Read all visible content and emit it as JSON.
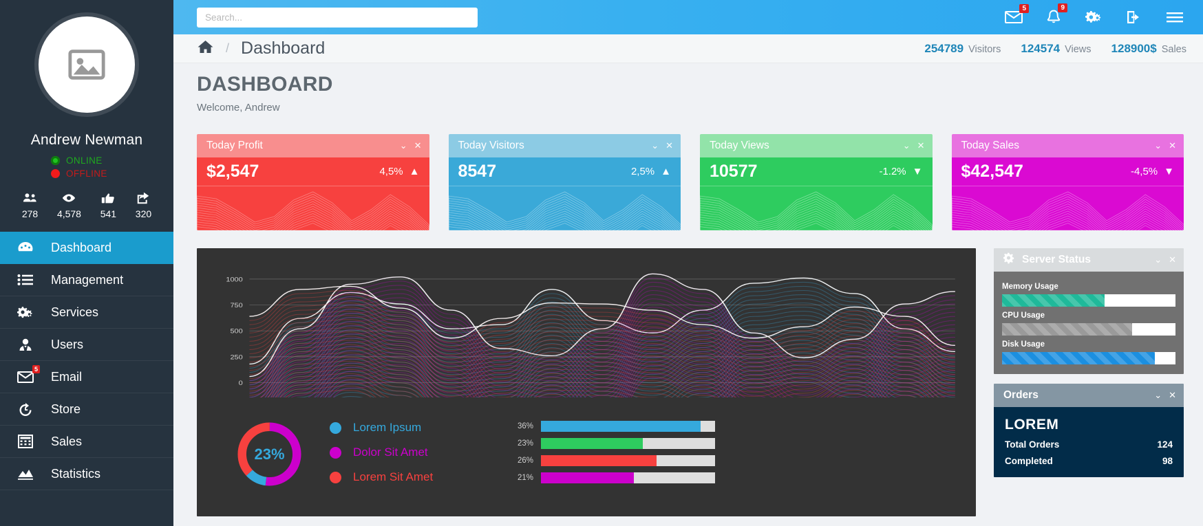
{
  "sidebar": {
    "user": {
      "name": "Andrew Newman",
      "avatar_icon": "image-placeholder-icon",
      "status_online": "ONLINE",
      "status_offline": "OFFLINE"
    },
    "metrics": [
      {
        "icon": "users-icon",
        "value": "278"
      },
      {
        "icon": "eye-icon",
        "value": "4,578"
      },
      {
        "icon": "thumbs-up-icon",
        "value": "541"
      },
      {
        "icon": "share-icon",
        "value": "320"
      }
    ],
    "items": [
      {
        "label": "Dashboard",
        "icon": "dashboard-icon",
        "active": true,
        "badge": ""
      },
      {
        "label": "Management",
        "icon": "list-icon",
        "active": false,
        "badge": ""
      },
      {
        "label": "Services",
        "icon": "gears-icon",
        "active": false,
        "badge": ""
      },
      {
        "label": "Users",
        "icon": "user-icon",
        "active": false,
        "badge": ""
      },
      {
        "label": "Email",
        "icon": "envelope-icon",
        "active": false,
        "badge": "5"
      },
      {
        "label": "Store",
        "icon": "history-icon",
        "active": false,
        "badge": ""
      },
      {
        "label": "Sales",
        "icon": "calculator-icon",
        "active": false,
        "badge": ""
      },
      {
        "label": "Statistics",
        "icon": "area-chart-icon",
        "active": false,
        "badge": ""
      }
    ]
  },
  "topbar": {
    "search_placeholder": "Search...",
    "icons": [
      {
        "name": "envelope-icon",
        "badge": "5"
      },
      {
        "name": "bell-icon",
        "badge": "9"
      },
      {
        "name": "gears-icon",
        "badge": ""
      },
      {
        "name": "logout-icon",
        "badge": ""
      },
      {
        "name": "hamburger-icon",
        "badge": ""
      }
    ]
  },
  "breadcrumb": {
    "home_icon": "home-icon",
    "separator": "/",
    "title": "Dashboard",
    "stats": [
      {
        "value": "254789",
        "label": "Visitors"
      },
      {
        "value": "124574",
        "label": "Views"
      },
      {
        "value": "128900$",
        "label": "Sales"
      }
    ]
  },
  "page": {
    "heading": "DASHBOARD",
    "welcome": "Welcome, Andrew"
  },
  "stat_cards": [
    {
      "title": "Today Profit",
      "value": "$2,547",
      "percent": "4,5%",
      "arrow": "▲",
      "head_color": "#f88e8e",
      "body_color": "#f7413f",
      "spark_color": "#ffb3b3"
    },
    {
      "title": "Today Visitors",
      "value": "8547",
      "percent": "2,5%",
      "arrow": "▲",
      "head_color": "#8ccbe4",
      "body_color": "#3aa9d8",
      "spark_color": "#bfe4f3"
    },
    {
      "title": "Today Views",
      "value": "10577",
      "percent": "-1.2%",
      "arrow": "▼",
      "head_color": "#92e3a9",
      "body_color": "#2ecc5f",
      "spark_color": "#bdf0cc"
    },
    {
      "title": "Today Sales",
      "value": "$42,547",
      "percent": "-4,5%",
      "arrow": "▼",
      "head_color": "#e872e0",
      "body_color": "#da0ad2",
      "spark_color": "#f4a8f0"
    }
  ],
  "chart_data": {
    "type": "area",
    "title": "",
    "xlabel": "",
    "ylabel": "",
    "ylim": [
      0,
      1100
    ],
    "ytick_labels": [
      "1000",
      "750",
      "500",
      "250",
      "0"
    ],
    "ytick_values": [
      1000,
      750,
      500,
      250,
      0
    ],
    "grid": true,
    "legend_position": "bottom-left",
    "series": [
      {
        "name": "Lorem Ipsum",
        "color": "#35a9dd",
        "values": [
          180,
          620,
          870,
          760,
          520,
          560,
          900,
          600,
          480,
          700,
          960,
          1010,
          860,
          520,
          300
        ]
      },
      {
        "name": "Dolor Sit Amet",
        "color": "#cc00cc",
        "values": [
          60,
          520,
          950,
          1020,
          700,
          330,
          260,
          520,
          1050,
          900,
          480,
          240,
          420,
          760,
          880
        ]
      },
      {
        "name": "Lorem Sit Amet",
        "color": "#f7413f",
        "values": [
          640,
          900,
          930,
          720,
          430,
          620,
          770,
          760,
          700,
          560,
          430,
          540,
          730,
          640,
          360
        ]
      }
    ]
  },
  "donut": {
    "center_label": "23%",
    "slices": [
      {
        "name": "Dolor Sit Amet",
        "color": "#cc00cc",
        "percent": 52
      },
      {
        "name": "Lorem Ipsum",
        "color": "#35a9dd",
        "percent": 11
      },
      {
        "name": "Lorem Sit Amet",
        "color": "#f7413f",
        "percent": 37
      }
    ]
  },
  "legend": [
    {
      "label": "Lorem Ipsum",
      "color": "#35a9dd"
    },
    {
      "label": "Dolor Sit Amet",
      "color": "#cc00cc"
    },
    {
      "label": "Lorem Sit Amet",
      "color": "#f7413f"
    }
  ],
  "progress_bars": [
    {
      "percent_label": "36%",
      "percent": 36,
      "color": "#35a9dd"
    },
    {
      "percent_label": "23%",
      "percent": 23,
      "color": "#2ecc5f"
    },
    {
      "percent_label": "26%",
      "percent": 26,
      "color": "#f7413f"
    },
    {
      "percent_label": "21%",
      "percent": 21,
      "color": "#cc00cc"
    }
  ],
  "server_status": {
    "title": "Server Status",
    "icon": "gear-icon",
    "bars": [
      {
        "label": "Memory Usage",
        "percent": 59,
        "color": "#1fb99a"
      },
      {
        "label": "CPU Usage",
        "percent": 75,
        "color": "#9a9a9a"
      },
      {
        "label": "Disk Usage",
        "percent": 88,
        "color": "#1b8fe0"
      }
    ]
  },
  "orders": {
    "title": "Orders",
    "heading": "LOREM",
    "rows": [
      {
        "label": "Total Orders",
        "value": "124"
      },
      {
        "label": "Completed",
        "value": "98"
      }
    ]
  },
  "controls": {
    "collapse": "⌄",
    "close": "✕"
  }
}
